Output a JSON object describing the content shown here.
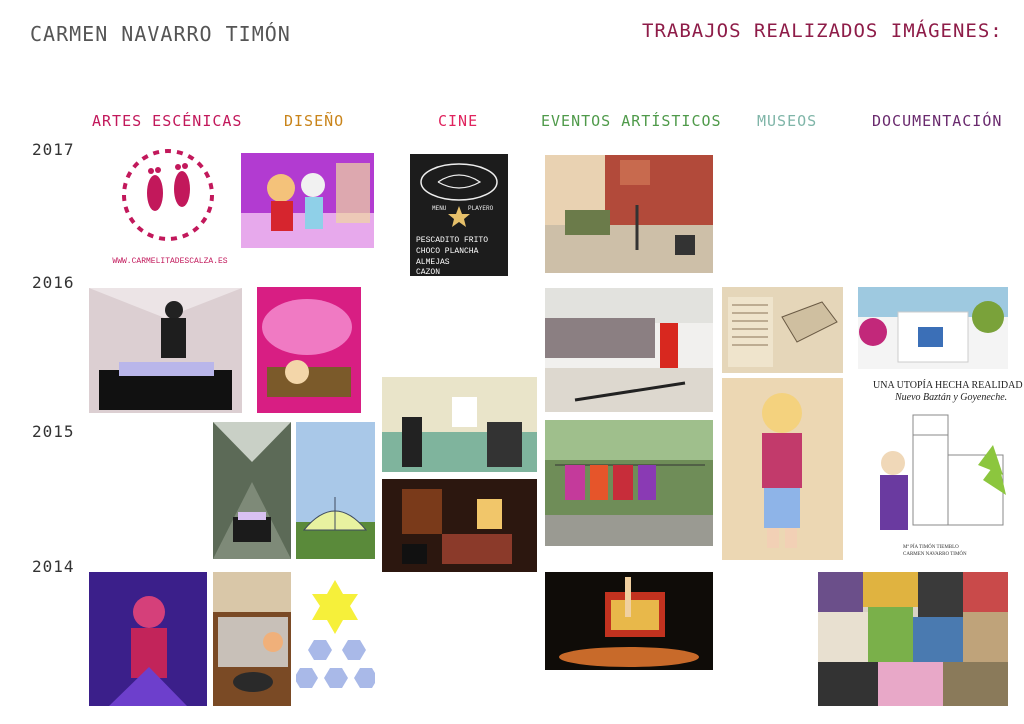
{
  "author": "CARMEN NAVARRO TIMÓN",
  "title": "TRABAJOS REALIZADOS IMÁGENES:",
  "categories": [
    {
      "label": "ARTES ESCÉNICAS",
      "color": "#c2185b"
    },
    {
      "label": "DISEÑO",
      "color": "#c9841a"
    },
    {
      "label": "CINE",
      "color": "#e0245e"
    },
    {
      "label": "EVENTOS ARTÍSTICOS",
      "color": "#4f9a4a"
    },
    {
      "label": "MUSEOS",
      "color": "#7fb5a8"
    },
    {
      "label": "DOCUMENTACIÓN",
      "color": "#6a2a6e"
    }
  ],
  "years": [
    "2017",
    "2016",
    "2015",
    "2014"
  ],
  "logo": {
    "url": "WWW.CARMELITADESCALZA.ES"
  },
  "menu_board": {
    "menu": "MENU",
    "playero": "PLAYERO",
    "lines": [
      "PESCADITO FRITO",
      "CHOCO PLANCHA",
      "ALMEJAS",
      "CAZON"
    ]
  },
  "museum_text": {
    "line1": "UNA UTOPÍA HECHA REALIDAD",
    "line2": "Nuevo Baztán y Goyeneche.",
    "credit1": "Mª PÍA TIMÓN TIEMBLO",
    "credit2": "CARMEN NAVARRO TIMÓN"
  }
}
